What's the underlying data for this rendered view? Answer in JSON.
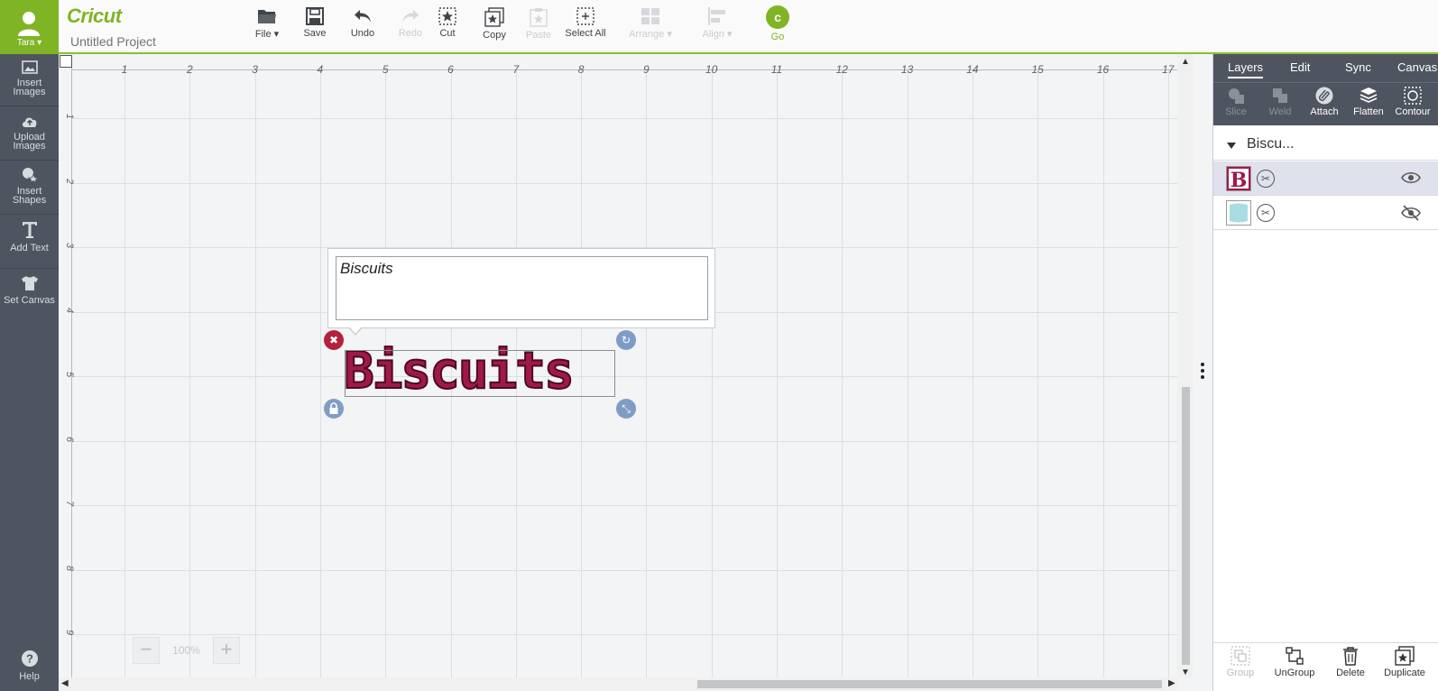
{
  "user": {
    "name": "Tara ▾"
  },
  "project": {
    "logo": "Cricut",
    "title": "Untitled Project"
  },
  "left_nav": [
    {
      "label": "Insert Images",
      "icon": "image-icon"
    },
    {
      "label": "Upload Images",
      "icon": "upload-cloud-icon"
    },
    {
      "label": "Insert Shapes",
      "icon": "shapes-icon"
    },
    {
      "label": "Add Text",
      "icon": "text-icon"
    },
    {
      "label": "Set Canvas",
      "icon": "tshirt-icon"
    }
  ],
  "help_label": "Help",
  "toolbar": {
    "file": "File ▾",
    "save": "Save",
    "undo": "Undo",
    "redo": "Redo",
    "cut": "Cut",
    "copy": "Copy",
    "paste": "Paste",
    "select_all": "Select All",
    "arrange": "Arrange ▾",
    "align": "Align ▾",
    "go": "Go"
  },
  "ruler": {
    "horizontal": [
      "1",
      "2",
      "3",
      "4",
      "5",
      "6",
      "7",
      "8",
      "9",
      "10",
      "11",
      "12",
      "13",
      "14",
      "15",
      "16",
      "17"
    ],
    "vertical": [
      "1",
      "2",
      "3",
      "4",
      "5",
      "6",
      "7",
      "8",
      "9"
    ]
  },
  "text_editor": {
    "value": "Biscuits"
  },
  "canvas_text": "Biscuits",
  "zoom": {
    "level": "100%",
    "minus": "−",
    "plus": "+"
  },
  "panel": {
    "tabs": [
      "Layers",
      "Edit",
      "Sync",
      "Canvas"
    ],
    "active_tab": "Layers",
    "tools": [
      {
        "label": "Slice",
        "enabled": false
      },
      {
        "label": "Weld",
        "enabled": false
      },
      {
        "label": "Attach",
        "enabled": true
      },
      {
        "label": "Flatten",
        "enabled": true
      },
      {
        "label": "Contour",
        "enabled": true
      }
    ],
    "group_name": "Biscu...",
    "layers": [
      {
        "thumb": "B",
        "color": "#a0184a",
        "visible": true,
        "selected": true
      },
      {
        "thumb": "",
        "color": "#a9dde3",
        "visible": false,
        "selected": false
      }
    ],
    "bottom": [
      {
        "label": "Group",
        "enabled": false
      },
      {
        "label": "UnGroup",
        "enabled": true
      },
      {
        "label": "Delete",
        "enabled": true
      },
      {
        "label": "Duplicate",
        "enabled": true
      }
    ]
  },
  "colors": {
    "brand_green": "#7fb424",
    "rail": "#4f5560",
    "text_fill": "#a0184a",
    "handle_close": "#b5203a",
    "handle_blue": "#7f9cc5"
  }
}
